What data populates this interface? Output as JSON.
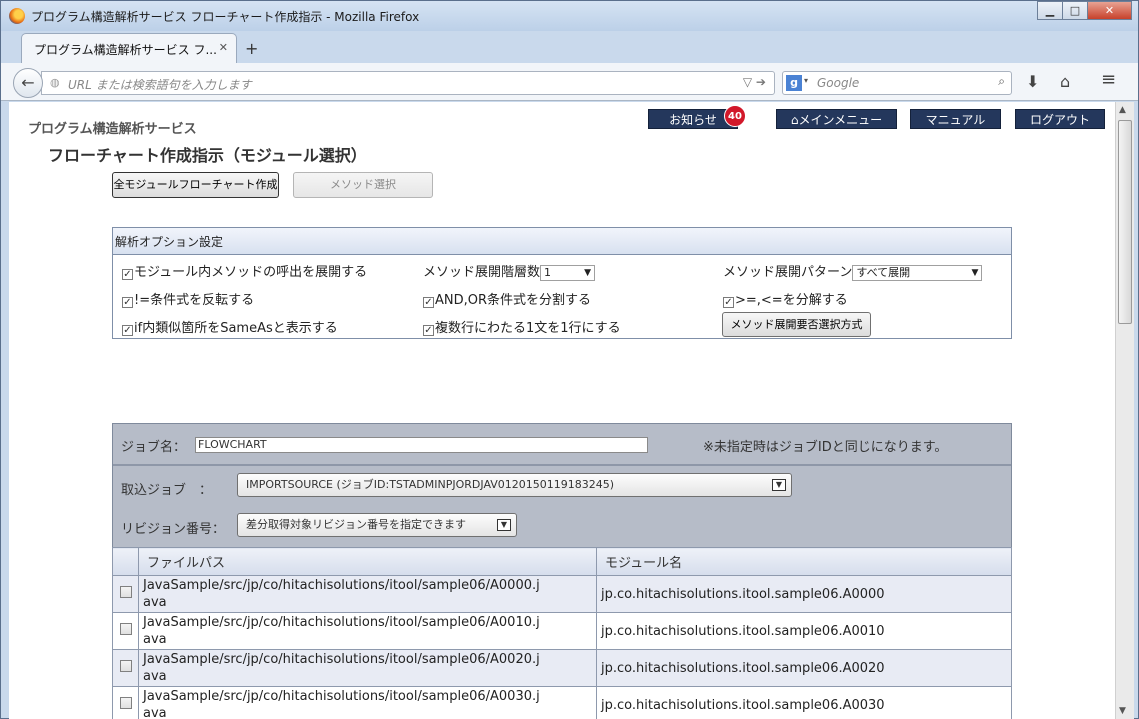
{
  "browser": {
    "window_title": "プログラム構造解析サービス フローチャート作成指示 - Mozilla Firefox",
    "tab_label": "プログラム構造解析サービス フ...",
    "url_placeholder": "URL または検索語句を入力します",
    "search_placeholder": "Google",
    "new_tab": "+"
  },
  "header": {
    "site_title": "プログラム構造解析サービス",
    "page_title": "フローチャート作成指示（モジュール選択）",
    "notice_label": "お知らせ",
    "notice_count": "40",
    "main_menu": "メインメニュー",
    "manual": "マニュアル",
    "logout": "ログアウト"
  },
  "actions": {
    "all_module_flowchart": "全モジュールフローチャート作成",
    "method_select": "メソッド選択"
  },
  "options": {
    "header": "解析オプション設定",
    "expand_calls": "モジュール内メソッドの呼出を展開する",
    "invert_neq": "!=条件式を反転する",
    "if_sameas": "if内類似箇所をSameAsと表示する",
    "depth_label": "メソッド展開階層数",
    "depth_value": "1",
    "split_and_or": "AND,OR条件式を分割する",
    "multi_line": "複数行にわたる1文を1行にする",
    "pattern_label": "メソッド展開パターン",
    "pattern_value": "すべて展開",
    "decompose_ge_le": ">=,<=を分解する",
    "select_mode_button": "メソッド展開要否選択方式"
  },
  "job": {
    "name_label": "ジョブ名：",
    "name_value": "FLOWCHART",
    "name_note": "※未指定時はジョブIDと同じになります。",
    "import_label": "取込ジョブ　：",
    "import_value": "IMPORTSOURCE (ジョブID:TSTADMINPJORDJAV0120150119183245)",
    "revision_label": "リビジョン番号：",
    "revision_value": "差分取得対象リビジョン番号を指定できます"
  },
  "table": {
    "col_path": "ファイルパス",
    "col_module": "モジュール名",
    "rows": [
      {
        "path1": "JavaSample/src/jp/co/hitachisolutions/itool/sample06/A0000.j",
        "path2": "ava",
        "module": "jp.co.hitachisolutions.itool.sample06.A0000"
      },
      {
        "path1": "JavaSample/src/jp/co/hitachisolutions/itool/sample06/A0010.j",
        "path2": "ava",
        "module": "jp.co.hitachisolutions.itool.sample06.A0010"
      },
      {
        "path1": "JavaSample/src/jp/co/hitachisolutions/itool/sample06/A0020.j",
        "path2": "ava",
        "module": "jp.co.hitachisolutions.itool.sample06.A0020"
      },
      {
        "path1": "JavaSample/src/jp/co/hitachisolutions/itool/sample06/A0030.j",
        "path2": "ava",
        "module": "jp.co.hitachisolutions.itool.sample06.A0030"
      }
    ]
  }
}
